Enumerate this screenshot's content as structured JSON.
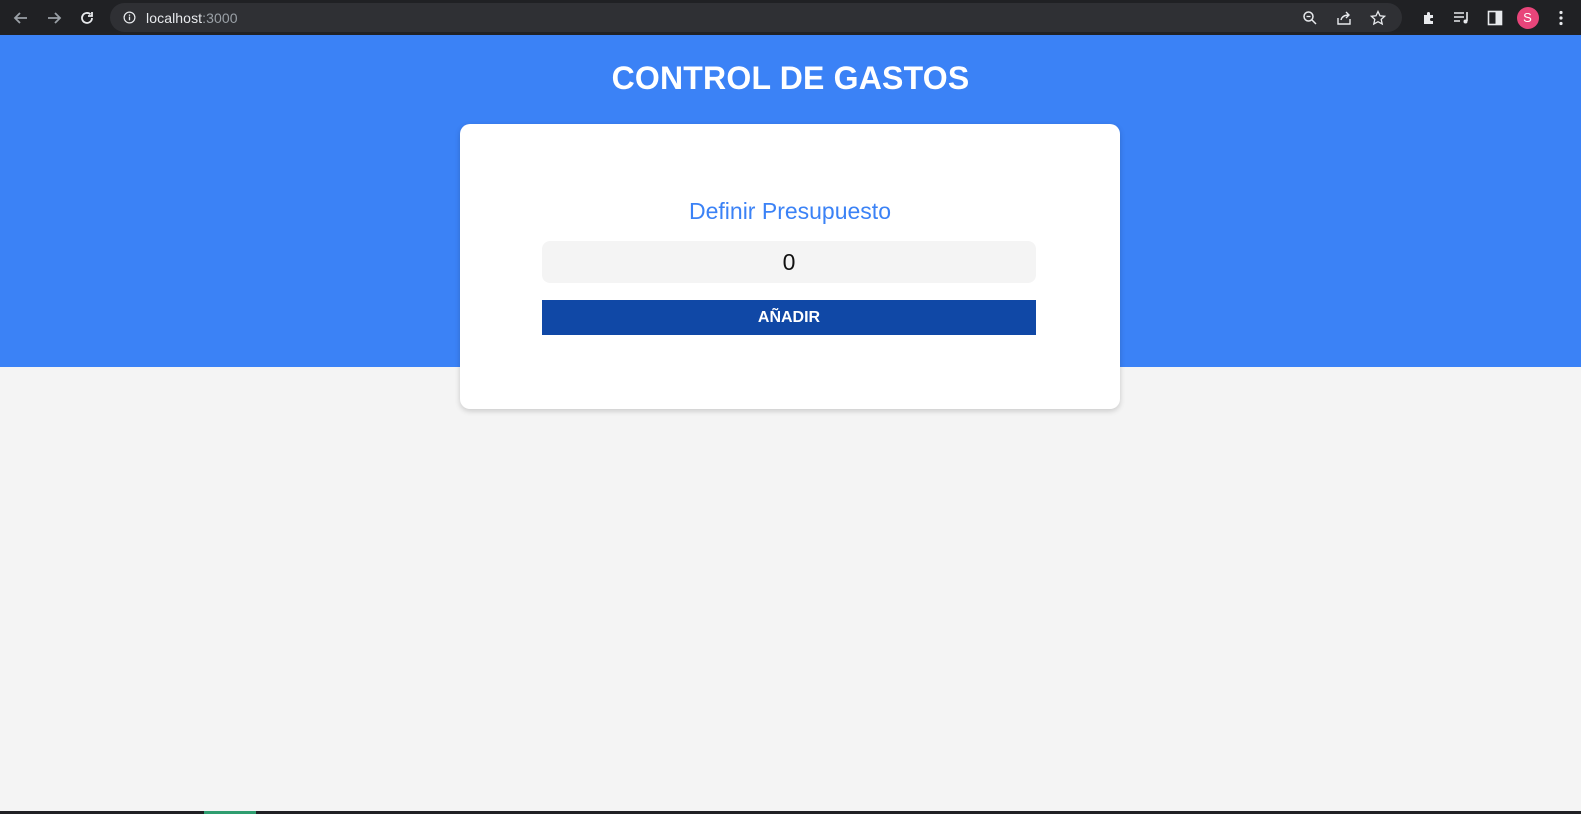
{
  "browser": {
    "url_host": "localhost",
    "url_port": ":3000",
    "profile_initial": "S",
    "icons": {
      "back": "arrow-left-icon",
      "forward": "arrow-right-icon",
      "reload": "reload-icon",
      "site_info": "info-icon",
      "zoom": "zoom-icon",
      "share": "share-icon",
      "bookmark": "star-icon",
      "extensions": "puzzle-icon",
      "media": "media-queue-icon",
      "side_panel": "side-panel-icon",
      "menu": "kebab-menu-icon"
    }
  },
  "header": {
    "title": "CONTROL DE GASTOS"
  },
  "budget_form": {
    "label": "Definir Presupuesto",
    "input_value": "0",
    "submit_label": "AÑADIR"
  },
  "colors": {
    "hero_bg": "#3b82f6",
    "label": "#3b82f6",
    "button_bg": "#1048a6",
    "page_bg": "#f4f4f4"
  }
}
